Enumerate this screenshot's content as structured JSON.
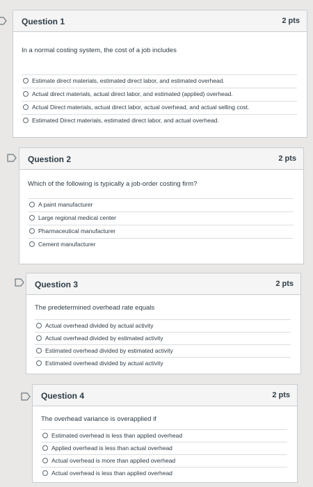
{
  "questions": [
    {
      "title": "Question 1",
      "points": "2 pts",
      "text": "In a normal costing system, the cost of a job includes",
      "options": [
        "Estimate direct materials, estimated direct labor, and estimated overhead.",
        "Actual direct materials, actual direct labor, and estimated (applied) overhead.",
        "Actual Direct materials, actual direct labor, actual overhead, and actual selling cost.",
        "Estimated Direct materials, estimated direct labor, and actual overhead."
      ]
    },
    {
      "title": "Question 2",
      "points": "2 pts",
      "text": "Which of the following is typically a job-order costing firm?",
      "options": [
        "A paint manufacturer",
        "Large regional medical center",
        "Pharmaceutical manufacturer",
        "Cement manufacturer"
      ]
    },
    {
      "title": "Question 3",
      "points": "2 pts",
      "text": "The predetermined overhead rate equals",
      "options": [
        "Actual overhead divided by actual activity",
        "Actual overhead divided by estimated activity",
        "Estimated overhead divided by estimated activity",
        "Estimated overhead divided by actual activity"
      ]
    },
    {
      "title": "Question 4",
      "points": "2 pts",
      "text": "The overhead variance is overapplied if",
      "options": [
        "Estimated overhead is less than applied overhead",
        "Applied overhead is less than actual overhead",
        "Actual overhead is more than applied overhead",
        "Actual overhead is less than applied overhead"
      ]
    }
  ]
}
